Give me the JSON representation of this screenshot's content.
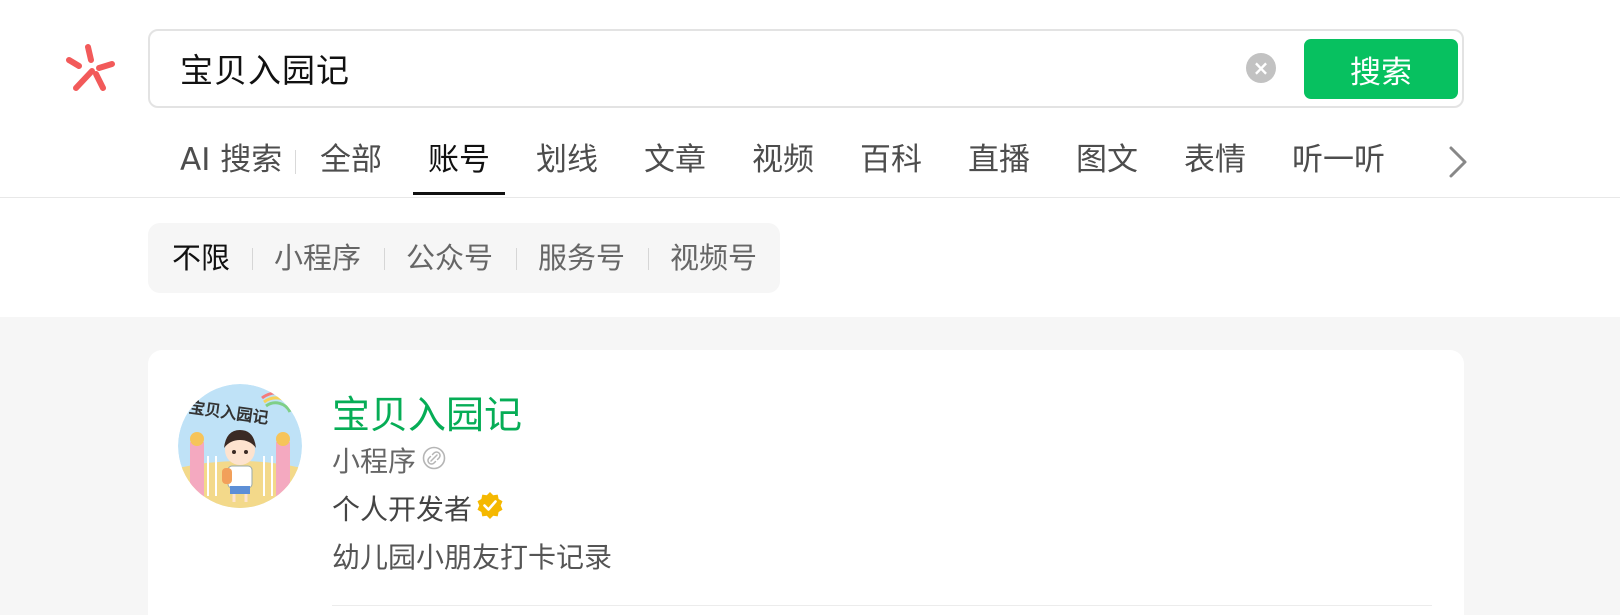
{
  "search": {
    "query": "宝贝入园记",
    "clear_symbol": "×",
    "button_label": "搜索"
  },
  "tabs": [
    {
      "label": "AI 搜索"
    },
    {
      "label": "全部"
    },
    {
      "label": "账号"
    },
    {
      "label": "划线"
    },
    {
      "label": "文章"
    },
    {
      "label": "视频"
    },
    {
      "label": "百科"
    },
    {
      "label": "直播"
    },
    {
      "label": "图文"
    },
    {
      "label": "表情"
    },
    {
      "label": "听一听"
    }
  ],
  "active_tab": "账号",
  "filters": [
    {
      "label": "不限"
    },
    {
      "label": "小程序"
    },
    {
      "label": "公众号"
    },
    {
      "label": "服务号"
    },
    {
      "label": "视频号"
    }
  ],
  "active_filter": "不限",
  "result": {
    "title": "宝贝入园记",
    "type": "小程序",
    "developer": "个人开发者",
    "description": "幼儿园小朋友打卡记录",
    "avatar_text": "宝贝入园记"
  },
  "icons": {
    "logo": "wechat-search-logo-icon",
    "clear": "clear-icon",
    "arrow": "chevron-right-icon",
    "link": "mini-program-link-icon",
    "verified": "verified-badge-icon"
  },
  "colors": {
    "accent_green": "#07c160",
    "title_green": "#06ad56",
    "logo_red": "#f25a5a",
    "verified_gold": "#f5b800"
  }
}
